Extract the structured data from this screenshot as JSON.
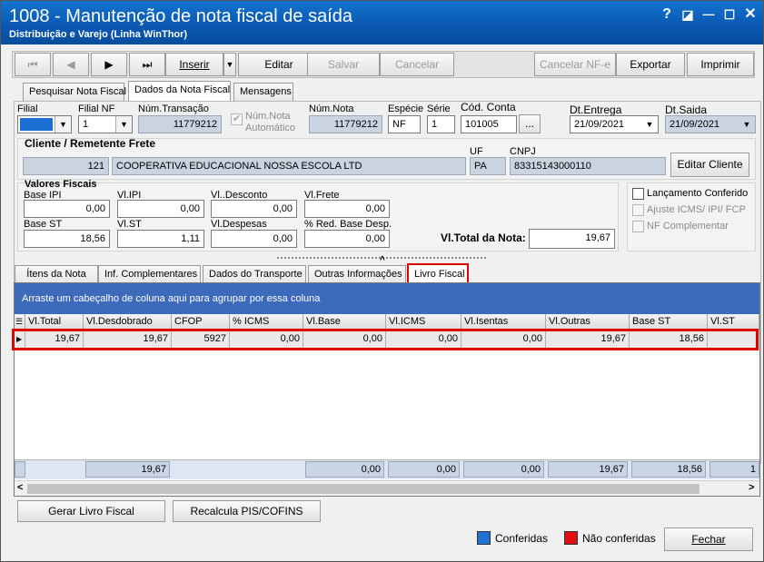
{
  "window": {
    "title": "1008 - Manutenção de nota fiscal de saída",
    "subtitle": "Distribuição e Varejo (Linha WinThor)",
    "help": "?",
    "restore": "◪",
    "minimize": "—",
    "maximize": "☐",
    "close": "✕"
  },
  "toolbar": {
    "first": "⏮",
    "prev": "◀",
    "next": "▶",
    "last": "⏭",
    "inserir": "Inserir",
    "inserir_dd": "▼",
    "editar": "Editar",
    "salvar": "Salvar",
    "cancelar": "Cancelar",
    "cancelar_nfe": "Cancelar NF-e",
    "exportar": "Exportar",
    "imprimir": "Imprimir"
  },
  "top_tabs": [
    "Pesquisar Nota Fiscal",
    "Dados da Nota Fiscal",
    "Mensagens"
  ],
  "header": {
    "filial_label": "Filial",
    "filial_value": "",
    "filial_nf_label": "Filial NF",
    "filial_nf_value": "1",
    "num_transacao_label": "Núm.Transação",
    "num_transacao_value": "11779212",
    "num_nota_auto_label1": "Núm.Nota",
    "num_nota_auto_label2": "Automático",
    "num_nota_label": "Núm.Nota",
    "num_nota_value": "11779212",
    "especie_label": "Espécie",
    "especie_value": "NF",
    "serie_label": "Série",
    "serie_value": "1",
    "cod_conta_label": "Cód. Conta",
    "cod_conta_value": "101005",
    "cod_conta_btn": "...",
    "dt_entrega_label": "Dt.Entrega",
    "dt_entrega_value": "21/09/2021",
    "dt_saida_label": "Dt.Saida",
    "dt_saida_value": "21/09/2021"
  },
  "cliente": {
    "section_title": "Cliente / Remetente Frete",
    "uf_label": "UF",
    "cnpj_label": "CNPJ",
    "codigo": "121",
    "nome": "COOPERATIVA EDUCACIONAL NOSSA ESCOLA LTD",
    "uf": "PA",
    "cnpj": "83315143000110",
    "editar_btn": "Editar Cliente"
  },
  "valores": {
    "section_title": "Valores Fiscais",
    "base_ipi_label": "Base IPI",
    "base_ipi": "0,00",
    "vl_ipi_label": "Vl.IPI",
    "vl_ipi": "0,00",
    "vl_desconto_label": "Vl..Desconto",
    "vl_desconto": "0,00",
    "vl_frete_label": "Vl.Frete",
    "vl_frete": "0,00",
    "base_st_label": "Base ST",
    "base_st": "18,56",
    "vl_st_label": "Vl.ST",
    "vl_st": "1,11",
    "vl_despesas_label": "Vl.Despesas",
    "vl_despesas": "0,00",
    "red_base_label": "% Red. Base Desp.",
    "red_base": "0,00",
    "total_label": "Vl.Total da Nota:",
    "total": "19,67"
  },
  "options": {
    "lancamento": "Lançamento Conferido",
    "ajuste": "Ajuste ICMS/ IPI/ FCP",
    "nf_complementar": "NF Complementar"
  },
  "splitter": "^",
  "sub_tabs": [
    "Ítens da Nota",
    "Inf. Complementares",
    "Dados do Transporte",
    "Outras Informações",
    "Livro Fiscal"
  ],
  "grid": {
    "group_hint": "Arraste um cabeçalho de coluna aqui para agrupar por essa coluna",
    "header_icon": "☰",
    "row_marker": "▶",
    "columns": [
      "Vl.Total",
      "Vl.Desdobrado",
      "CFOP",
      "% ICMS",
      "Vl.Base",
      "Vl.ICMS",
      "Vl.Isentas",
      "Vl.Outras",
      "Base ST",
      "Vl.ST"
    ],
    "rows": [
      [
        "19,67",
        "19,67",
        "5927",
        "0,00",
        "0,00",
        "0,00",
        "0,00",
        "19,67",
        "18,56",
        ""
      ]
    ],
    "footer": [
      "",
      "19,67",
      "",
      "",
      "0,00",
      "0,00",
      "0,00",
      "19,67",
      "18,56",
      "1"
    ],
    "scroll_left": "<",
    "scroll_right": ">"
  },
  "actions": {
    "gerar": "Gerar Livro Fiscal",
    "recalcula": "Recalcula PIS/COFINS",
    "fechar": "Fechar"
  },
  "legend": {
    "conferidas": "Conferidas",
    "nao_conferidas": "Não conferidas",
    "conferidas_color": "#1e73d2",
    "nao_conferidas_color": "#e01010"
  },
  "colors": {
    "title_bar": "#0a5bb5",
    "grid_group_band": "#3b6bbd",
    "highlight": "#e00000"
  }
}
